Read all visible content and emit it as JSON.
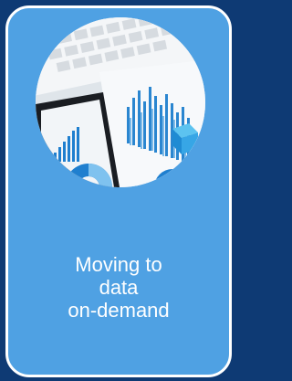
{
  "card": {
    "caption_lines": [
      "Moving to",
      "data",
      "on-demand"
    ],
    "image_icon": "analytics-dashboard-photo"
  },
  "colors": {
    "page_background": "#0e3a74",
    "card_background": "#4fa1e3",
    "card_border": "#ffffff",
    "caption_text": "#ffffff"
  }
}
